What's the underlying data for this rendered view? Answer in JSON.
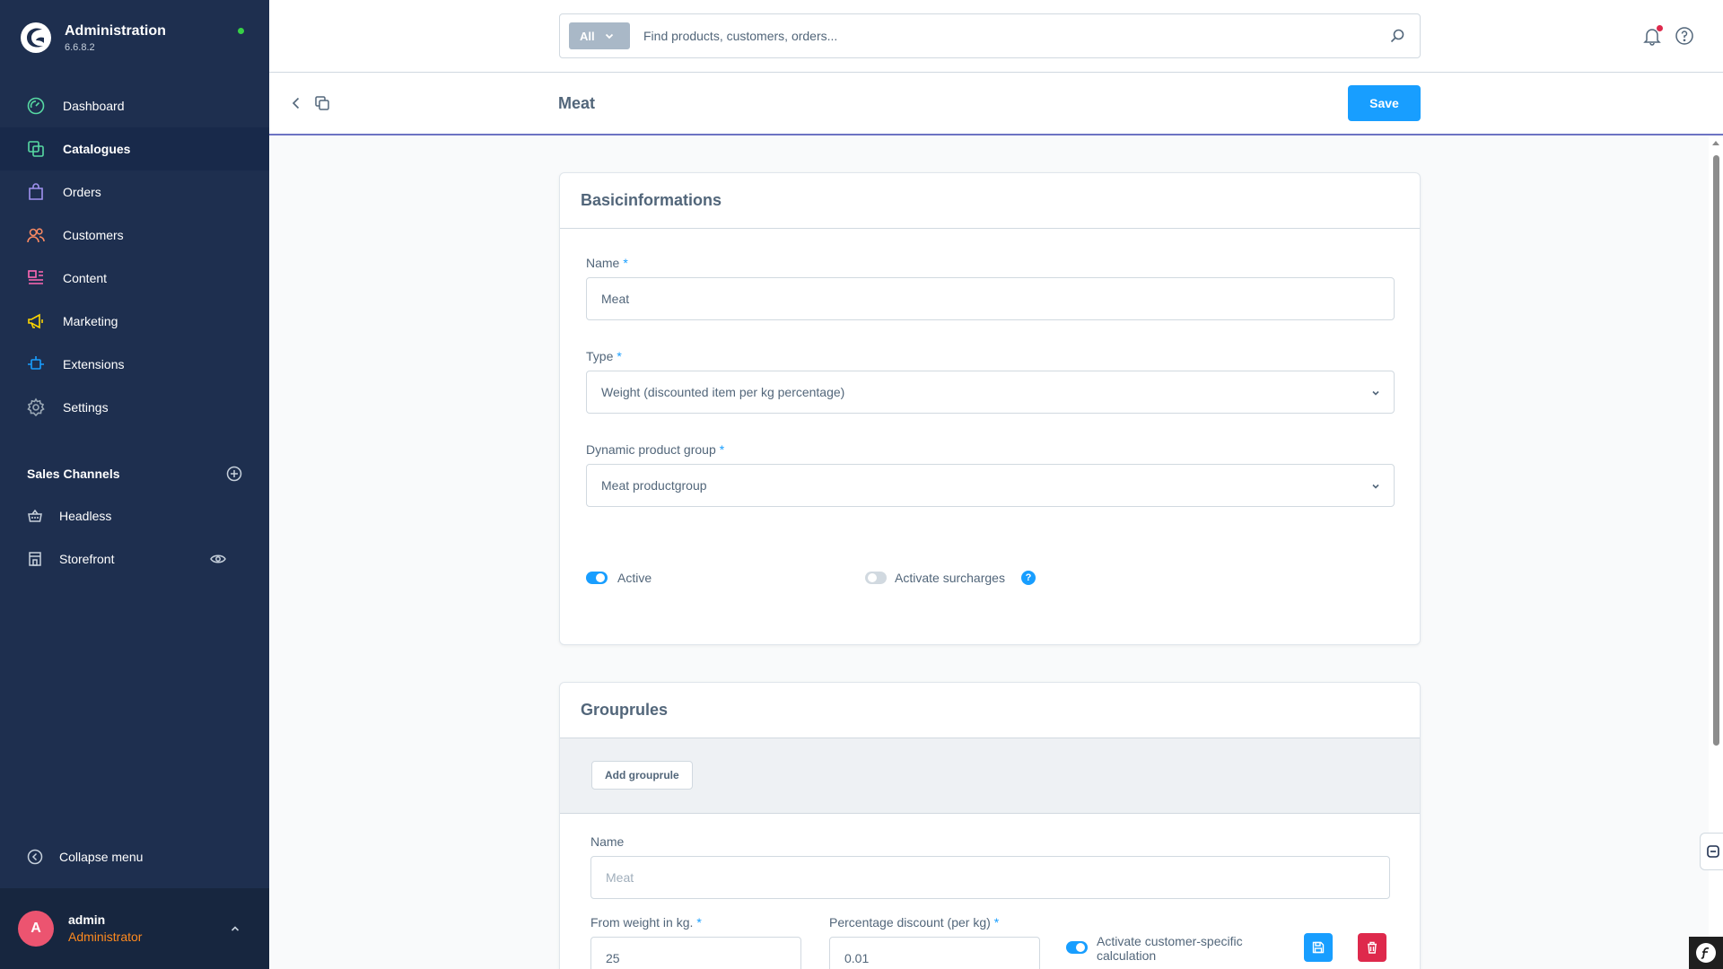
{
  "brand": {
    "title": "Administration",
    "version": "6.6.8.2",
    "status_color": "#37d046"
  },
  "nav": [
    {
      "label": "Dashboard",
      "icon": "dashboard-icon",
      "color": "#57d9a3"
    },
    {
      "label": "Catalogues",
      "icon": "catalogues-icon",
      "color": "#57d9a3",
      "active": true
    },
    {
      "label": "Orders",
      "icon": "orders-icon",
      "color": "#a092f0"
    },
    {
      "label": "Customers",
      "icon": "customers-icon",
      "color": "#f88962"
    },
    {
      "label": "Content",
      "icon": "content-icon",
      "color": "#ff68b4"
    },
    {
      "label": "Marketing",
      "icon": "marketing-icon",
      "color": "#ffd700"
    },
    {
      "label": "Extensions",
      "icon": "extensions-icon",
      "color": "#189eff"
    },
    {
      "label": "Settings",
      "icon": "settings-icon",
      "color": "#9aa8b5"
    }
  ],
  "sales_channels": {
    "header": "Sales Channels",
    "items": [
      {
        "label": "Headless",
        "icon": "basket-icon"
      },
      {
        "label": "Storefront",
        "icon": "storefront-icon"
      }
    ]
  },
  "collapse_label": "Collapse menu",
  "user": {
    "initial": "A",
    "name": "admin",
    "role": "Administrator"
  },
  "search": {
    "filter": "All",
    "placeholder": "Find products, customers, orders..."
  },
  "smartbar": {
    "title": "Meat",
    "save_label": "Save"
  },
  "basic": {
    "title": "Basicinformations",
    "name_label": "Name",
    "name_value": "Meat",
    "type_label": "Type",
    "type_value": "Weight (discounted item per kg percentage)",
    "group_label": "Dynamic product group",
    "group_value": "Meat productgroup",
    "active_label": "Active",
    "active": true,
    "surcharges_label": "Activate surcharges",
    "surcharges": false,
    "info_glyph": "?"
  },
  "grouprules": {
    "title": "Grouprules",
    "add_label": "Add grouprule",
    "name_label": "Name",
    "name_placeholder": "Meat",
    "weight_label": "From weight in kg.",
    "weight_value": "25",
    "discount_label": "Percentage discount (per kg)",
    "discount_value": "0.01",
    "customer_calc_label_1": "Activate customer-specific",
    "customer_calc_label_2": "calculation",
    "customer_calc": true
  },
  "colors": {
    "accent": "#189eff",
    "danger": "#de294c",
    "sidebar": "#1e2f4f",
    "role": "#ff8a1e"
  }
}
